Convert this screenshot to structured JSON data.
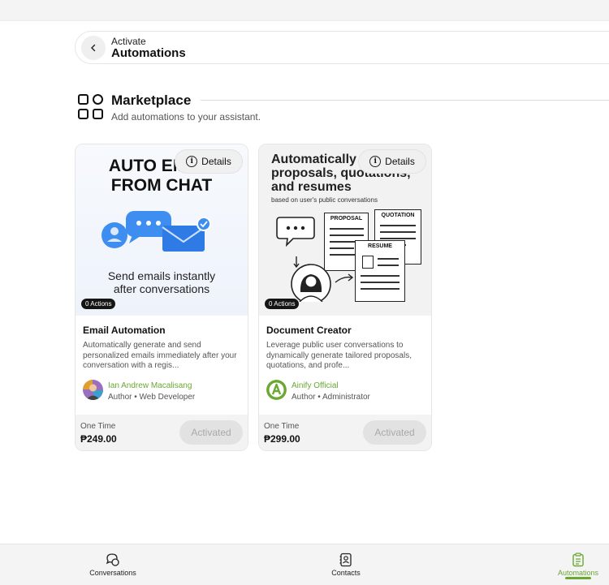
{
  "header": {
    "back_icon": "chevron-left-icon",
    "subtitle": "Activate",
    "title": "Automations"
  },
  "marketplace": {
    "icon": "apps-grid-icon",
    "title": "Marketplace",
    "subtitle": "Add automations to your assistant."
  },
  "cards": [
    {
      "thumbnail": {
        "headline_line1": "AUTO EMAIL",
        "headline_line2": "FROM CHAT",
        "tagline_line1": "Send emails instantly",
        "tagline_line2": "after conversations"
      },
      "details_label": "Details",
      "actions_badge": "0 Actions",
      "title": "Email Automation",
      "description": "Automatically generate and send personalized emails immediately after your conversation with a regis...",
      "author_name": "Ian Andrew Macalisang",
      "author_role": "Author • Web Developer",
      "price_type": "One Time",
      "price": "₱249.00",
      "button_label": "Activated"
    },
    {
      "thumbnail": {
        "headline_line1": "Automatically generate",
        "headline_line2": "proposals, quotations,",
        "headline_line3": "and resumes",
        "subline": "based on user's public conversations",
        "doc1": "PROPOSAL",
        "doc2": "QUOTATION",
        "doc3": "RESUME"
      },
      "details_label": "Details",
      "actions_badge": "0 Actions",
      "title": "Document Creator",
      "description": "Leverage public user conversations to dynamically generate tailored proposals, quotations, and profe...",
      "author_name": "Ainify Official",
      "author_role": "Author • Administrator",
      "price_type": "One Time",
      "price": "₱299.00",
      "button_label": "Activated"
    }
  ],
  "bottom_nav": [
    {
      "label": "Conversations",
      "icon": "chat-bubbles-icon",
      "active": false
    },
    {
      "label": "Contacts",
      "icon": "contact-book-icon",
      "active": false
    },
    {
      "label": "Automations",
      "icon": "clipboard-icon",
      "active": true
    }
  ],
  "colors": {
    "accent": "#6aa832",
    "dark_badge": "#151515",
    "muted_button": "#e2e2e2"
  }
}
